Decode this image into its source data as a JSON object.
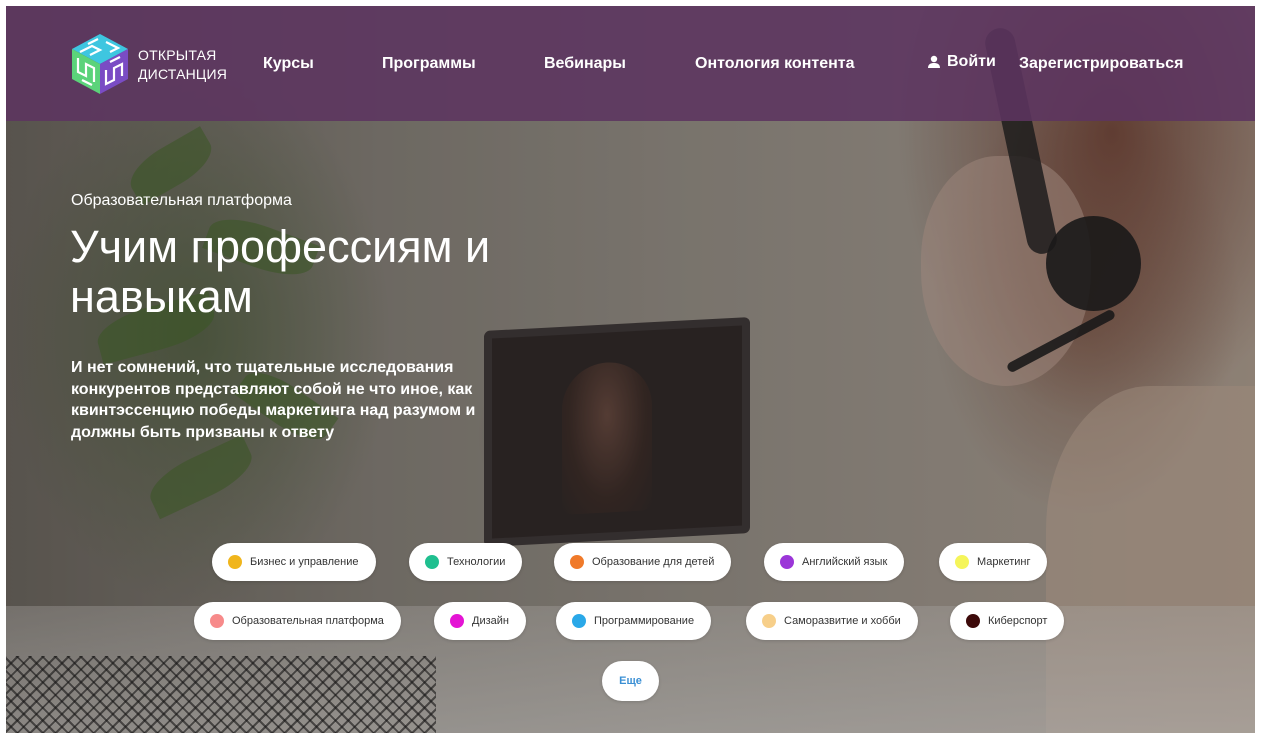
{
  "logo": {
    "line1": "ОТКРЫТАЯ",
    "line2": "ДИСТАНЦИЯ"
  },
  "nav": {
    "courses": "Курсы",
    "programs": "Программы",
    "webinars": "Вебинары",
    "ontology": "Онтология контента",
    "login": "Войти",
    "register": "Зарегистрироваться"
  },
  "hero": {
    "eyebrow": "Образовательная платформа",
    "title": "Учим профессиям и навыкам",
    "lead": "И нет сомнений, что тщательные исследования конкурентов представляют собой не что иное, как квинтэссенцию победы маркетинга над разумом и должны быть призваны к ответу"
  },
  "categories": [
    {
      "label": "Бизнес и управление",
      "color": "#f0b51c"
    },
    {
      "label": "Технологии",
      "color": "#1fbf8f"
    },
    {
      "label": "Образование для детей",
      "color": "#f07a2a"
    },
    {
      "label": "Английский язык",
      "color": "#9b36d8"
    },
    {
      "label": "Маркетинг",
      "color": "#f5f55a"
    },
    {
      "label": "Образовательная платформа",
      "color": "#f78a8a"
    },
    {
      "label": "Дизайн",
      "color": "#e414d4"
    },
    {
      "label": "Программирование",
      "color": "#2aa8e8"
    },
    {
      "label": "Саморазвитие и хобби",
      "color": "#f7cf8a"
    },
    {
      "label": "Киберспорт",
      "color": "#3d0a0a"
    }
  ],
  "more_label": "Еще",
  "colors": {
    "header_bg": "#5c3460",
    "accent_link": "#3a8fd4"
  }
}
